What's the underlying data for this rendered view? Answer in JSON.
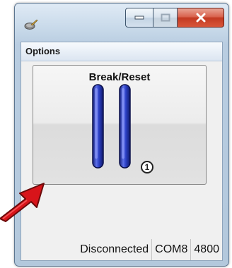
{
  "window": {
    "icon": "paintbrush-icon",
    "buttons": {
      "minimize": "minimize-icon",
      "maximize": "maximize-icon",
      "close": "close-icon"
    }
  },
  "menu": {
    "items": [
      {
        "label": "Options"
      }
    ]
  },
  "main": {
    "break_reset": {
      "label": "Break/Reset",
      "icon": "pause-icon",
      "badge": "1"
    }
  },
  "statusbar": {
    "connection": "Disconnected",
    "port": "COM8",
    "baud": "4800"
  },
  "colors": {
    "pause_bar": "#2b3fc4",
    "close_button": "#c8442c",
    "arrow": "#d8141a"
  }
}
